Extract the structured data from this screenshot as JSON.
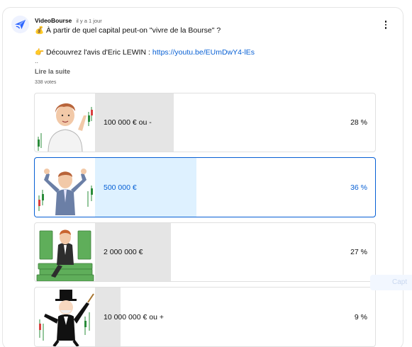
{
  "post": {
    "channel": "VideoBourse",
    "time": "il y a 1 jour",
    "question_icon": "💰",
    "question": "À partir de quel capital peut-on \"vivre de la Bourse\" ?",
    "promo_icon": "👉",
    "promo_text": "Découvrez l'avis d'Eric LEWIN : ",
    "promo_link": "https://youtu.be/EUmDwY4-lEs",
    "ellipsis": "..",
    "read_more": "Lire la suite",
    "votes": "338 votes"
  },
  "icons": {
    "avatar": "paper-plane-logo-icon",
    "menu": "more-vert-icon"
  },
  "poll": {
    "options": [
      {
        "label": "100 000 € ou -",
        "percent_text": "28 %",
        "percent": 28,
        "selected": false,
        "image": "casual-man-rock-gesture-chart"
      },
      {
        "label": "500 000 €",
        "percent_text": "36 %",
        "percent": 36,
        "selected": true,
        "image": "businessman-flexing-chart"
      },
      {
        "label": "2 000 000 €",
        "percent_text": "27 %",
        "percent": 27,
        "selected": false,
        "image": "man-on-money-pile"
      },
      {
        "label": "10 000 000 € ou +",
        "percent_text": "9 %",
        "percent": 9,
        "selected": false,
        "image": "monopoly-man-chart"
      }
    ]
  },
  "overlay": {
    "ghost_text": "Capt"
  },
  "colors": {
    "link": "#065fd4",
    "selected_fill": "#def1ff",
    "unselected_fill": "#e5e5e5",
    "selected_border": "#065fd4"
  }
}
